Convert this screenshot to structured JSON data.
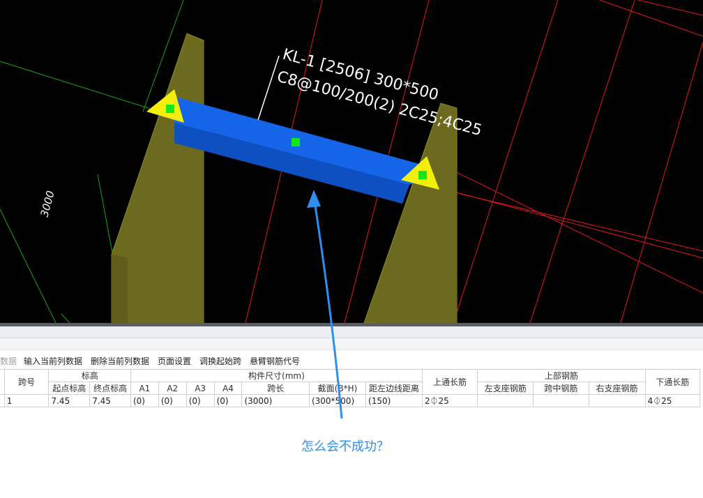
{
  "beam": {
    "label_line1": "KL-1 [2506] 300*500",
    "label_line2": "C8@100/200(2) 2C25;4C25",
    "dimension": "3000",
    "beam_color": "#1565e8",
    "column_color": "#6b6a1f",
    "grid_red": "#e0161c",
    "grid_green": "#19a319",
    "marker_yellow": "#f4ee0c",
    "marker_green": "#10e81a"
  },
  "toolbar": {
    "item0": "数据",
    "item1": "输入当前列数据",
    "item2": "删除当前列数据",
    "item3": "页面设置",
    "item4": "调换起始跨",
    "item5": "悬臂钢筋代号"
  },
  "table": {
    "h_span_no": "跨号",
    "h_elevation": "标高",
    "h_start_elev": "起点标高",
    "h_end_elev": "终点标高",
    "h_size": "构件尺寸(mm)",
    "h_a1": "A1",
    "h_a2": "A2",
    "h_a3": "A3",
    "h_a4": "A4",
    "h_span_len": "跨长",
    "h_section": "截面(B*H)",
    "h_edge_dist": "距左边线距离",
    "h_top_through": "上通长筋",
    "h_top_rebar": "上部钢筋",
    "h_left_support": "左支座钢筋",
    "h_mid_span": "跨中钢筋",
    "h_right_support": "右支座钢筋",
    "h_bottom_through": "下通长筋",
    "row": {
      "span_no": "1",
      "start_elev": "7.45",
      "end_elev": "7.45",
      "a1": "(0)",
      "a2": "(0)",
      "a3": "(0)",
      "a4": "(0)",
      "span_len": "(3000)",
      "section": "(300*500)",
      "edge_dist": "(150)",
      "top_through": "2⏀25",
      "left_support": "",
      "mid_span": "",
      "right_support": "",
      "bottom_through": "4⏀25"
    }
  },
  "annotation": {
    "caption": "怎么会不成功？",
    "arrow_color": "#2f8ff0"
  }
}
